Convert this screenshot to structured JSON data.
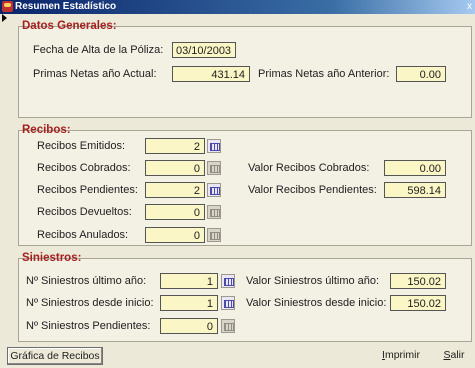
{
  "window": {
    "title": "Resumen Estadístico",
    "close": "x"
  },
  "datos_generales": {
    "title": "Datos Generales:",
    "fecha_alta_label": "Fecha de Alta de la Póliza:",
    "fecha_alta_value": "03/10/2003",
    "primas_actual_label": "Primas Netas año Actual:",
    "primas_actual_value": "431.14",
    "primas_anterior_label": "Primas Netas año Anterior:",
    "primas_anterior_value": "0.00"
  },
  "recibos": {
    "title": "Recibos:",
    "emitidos_label": "Recibos Emitidos:",
    "emitidos_value": "2",
    "cobrados_label": "Recibos Cobrados:",
    "cobrados_value": "0",
    "pendientes_label": "Recibos Pendientes:",
    "pendientes_value": "2",
    "devueltos_label": "Recibos Devueltos:",
    "devueltos_value": "0",
    "anulados_label": "Recibos Anulados:",
    "anulados_value": "0",
    "valor_cobrados_label": "Valor Recibos Cobrados:",
    "valor_cobrados_value": "0.00",
    "valor_pendientes_label": "Valor Recibos Pendientes:",
    "valor_pendientes_value": "598.14"
  },
  "siniestros": {
    "title": "Siniestros:",
    "ultimo_anio_label": "Nº Siniestros último año:",
    "ultimo_anio_value": "1",
    "desde_inicio_label": "Nº Siniestros desde inicio:",
    "desde_inicio_value": "1",
    "pendientes_label": "Nº Siniestros Pendientes:",
    "pendientes_value": "0",
    "valor_ultimo_anio_label": "Valor Siniestros último año:",
    "valor_ultimo_anio_value": "150.02",
    "valor_desde_inicio_label": "Valor Siniestros desde inicio:",
    "valor_desde_inicio_value": "150.02"
  },
  "buttons": {
    "grafica": "Gráfica de Recibos",
    "imprimir_first": "I",
    "imprimir_rest": "mprimir",
    "salir_first": "S",
    "salir_rest": "alir"
  }
}
